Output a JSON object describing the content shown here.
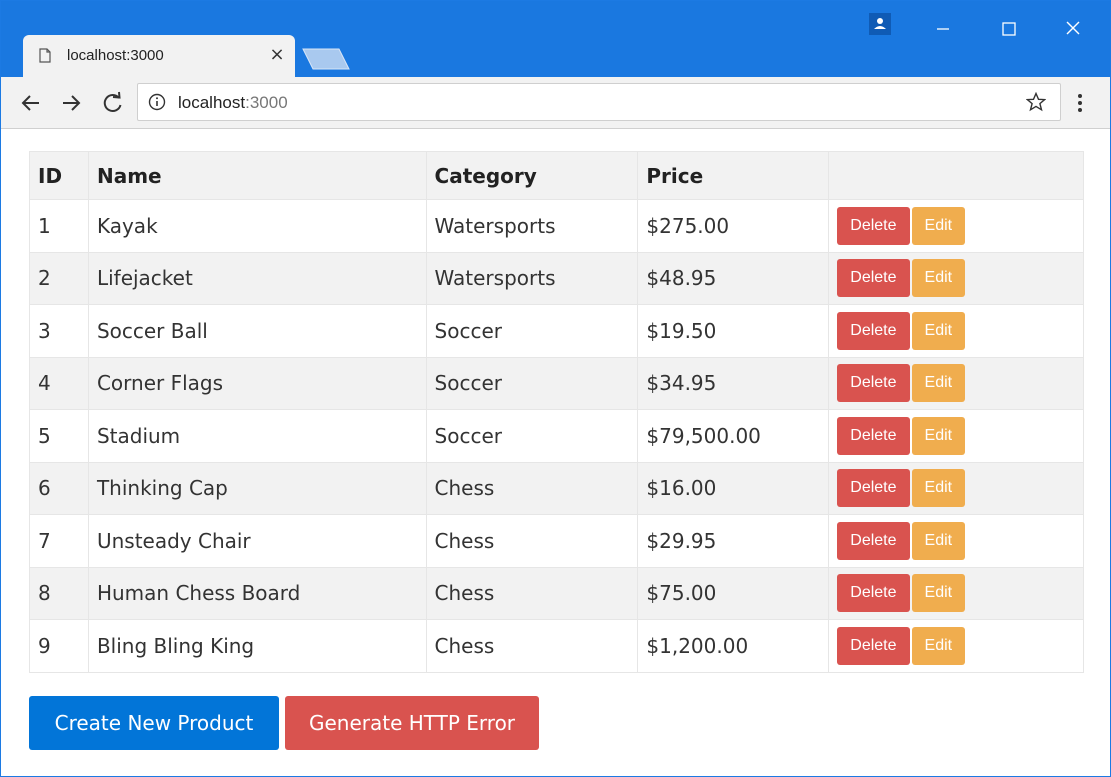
{
  "browser": {
    "tab_title": "localhost:3000",
    "tab_close_label": "×",
    "url_host": "localhost",
    "url_port": ":3000",
    "accent_color": "#1a78e0"
  },
  "table": {
    "headers": {
      "id": "ID",
      "name": "Name",
      "category": "Category",
      "price": "Price"
    },
    "rows": [
      {
        "id": "1",
        "name": "Kayak",
        "category": "Watersports",
        "price": "$275.00"
      },
      {
        "id": "2",
        "name": "Lifejacket",
        "category": "Watersports",
        "price": "$48.95"
      },
      {
        "id": "3",
        "name": "Soccer Ball",
        "category": "Soccer",
        "price": "$19.50"
      },
      {
        "id": "4",
        "name": "Corner Flags",
        "category": "Soccer",
        "price": "$34.95"
      },
      {
        "id": "5",
        "name": "Stadium",
        "category": "Soccer",
        "price": "$79,500.00"
      },
      {
        "id": "6",
        "name": "Thinking Cap",
        "category": "Chess",
        "price": "$16.00"
      },
      {
        "id": "7",
        "name": "Unsteady Chair",
        "category": "Chess",
        "price": "$29.95"
      },
      {
        "id": "8",
        "name": "Human Chess Board",
        "category": "Chess",
        "price": "$75.00"
      },
      {
        "id": "9",
        "name": "Bling Bling King",
        "category": "Chess",
        "price": "$1,200.00"
      }
    ],
    "delete_label": "Delete",
    "edit_label": "Edit",
    "delete_color": "#d9534f",
    "edit_color": "#f0ad4e"
  },
  "actions": {
    "create_label": "Create New Product",
    "error_label": "Generate HTTP Error",
    "create_color": "#0275d8",
    "error_color": "#d9534f"
  }
}
